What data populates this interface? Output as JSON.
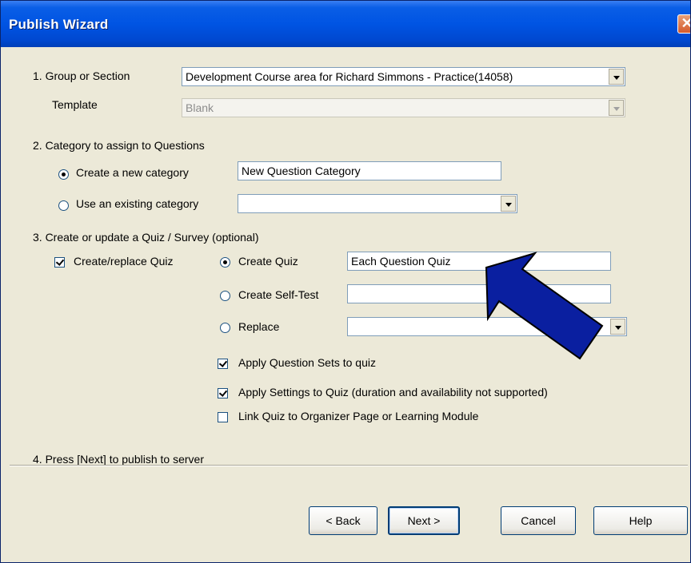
{
  "window": {
    "title": "Publish Wizard",
    "close_glyph": "✕"
  },
  "section1": {
    "label": "1. Group or Section",
    "group_value": "Development Course area for Richard Simmons - Practice(14058)",
    "template_label": "Template",
    "template_value": "Blank"
  },
  "section2": {
    "label": "2. Category to assign to Questions",
    "new_category_label": "Create a new category",
    "new_category_value": "New Question Category",
    "existing_category_label": "Use an existing category",
    "existing_category_value": ""
  },
  "section3": {
    "label": "3. Create or update a Quiz / Survey (optional)",
    "create_replace_label": "Create/replace Quiz",
    "create_quiz_label": "Create Quiz",
    "create_quiz_value": "Each Question Quiz",
    "create_selftest_label": "Create Self-Test",
    "create_selftest_value": "",
    "replace_label": "Replace",
    "replace_value": "",
    "apply_sets_label": "Apply Question Sets to quiz",
    "apply_settings_label": "Apply Settings to Quiz  (duration and availability not supported)",
    "link_quiz_label": "Link Quiz to Organizer Page or Learning Module"
  },
  "section4": {
    "label": "4. Press [Next] to publish to server"
  },
  "buttons": {
    "back": "< Back",
    "next": "Next >",
    "cancel": "Cancel",
    "help": "Help"
  },
  "state": {
    "category_choice": "new",
    "create_replace_checked": true,
    "quiz_choice": "create",
    "apply_sets_checked": true,
    "apply_settings_checked": true,
    "link_quiz_checked": false
  },
  "colors": {
    "titlebar": "#0054E3",
    "dialog_bg": "#ECE9D8",
    "annotation_arrow": "#0A1FA0"
  },
  "icons": {
    "annotation": "arrow-annotation-icon",
    "close": "close-icon",
    "dropdown": "chevron-down-icon"
  }
}
